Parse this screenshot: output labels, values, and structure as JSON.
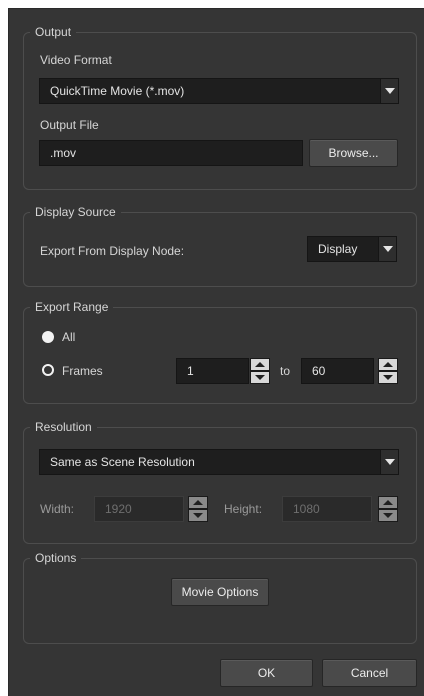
{
  "output": {
    "title": "Output",
    "video_format_label": "Video Format",
    "video_format_value": "QuickTime Movie (*.mov)",
    "output_file_label": "Output File",
    "output_file_value": ".mov",
    "browse_label": "Browse..."
  },
  "display_source": {
    "title": "Display Source",
    "export_label": "Export From Display Node:",
    "display_value": "Display"
  },
  "export_range": {
    "title": "Export Range",
    "all_label": "All",
    "frames_label": "Frames",
    "selected": "All",
    "from_value": "1",
    "to_label": "to",
    "to_value": "60"
  },
  "resolution": {
    "title": "Resolution",
    "preset_value": "Same as Scene Resolution",
    "width_label": "Width:",
    "width_value": "1920",
    "height_label": "Height:",
    "height_value": "1080"
  },
  "options": {
    "title": "Options",
    "movie_options_label": "Movie Options"
  },
  "footer": {
    "ok_label": "OK",
    "cancel_label": "Cancel"
  }
}
